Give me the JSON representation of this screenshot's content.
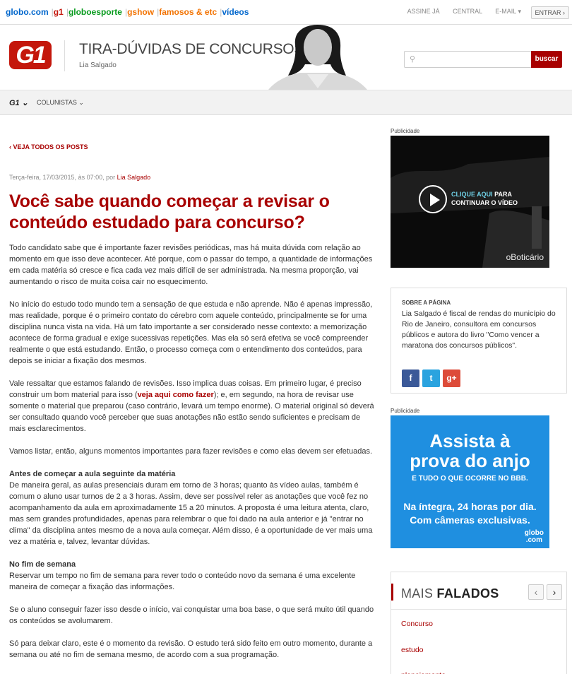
{
  "topbar": {
    "sites": [
      {
        "label": "globo.com",
        "color": "#0066cc"
      },
      {
        "label": "g1",
        "color": "#c4170c"
      },
      {
        "label": "globoesporte",
        "color": "#069a1c"
      },
      {
        "label": "gshow",
        "color": "#f27200"
      },
      {
        "label": "famosos & etc",
        "color": "#f27200"
      },
      {
        "label": "vídeos",
        "color": "#0066cc"
      }
    ],
    "links": [
      "ASSINE JÁ",
      "CENTRAL",
      "E-MAIL ▾"
    ],
    "entrar": "ENTRAR ›"
  },
  "header": {
    "logo": "G1",
    "blog_title": "TIRA-DÚVIDAS DE CONCURSOS",
    "blog_author": "Lia Salgado",
    "search_button": "buscar",
    "search_placeholder": ""
  },
  "nav": {
    "g1": "G1 ⌄",
    "colunistas": "COLUNISTAS ⌄"
  },
  "article": {
    "back_link": "‹ VEJA TODOS OS POSTS",
    "meta_date": "Terça-feira, 17/03/2015, às 07:00, por ",
    "meta_author": "Lia Salgado",
    "headline": "Você sabe quando começar a revisar o conteúdo estudado para concurso?",
    "p1": "Todo candidato sabe que é importante fazer revisões periódicas, mas há muita dúvida com relação ao momento em que isso deve acontecer. Até porque, com o passar do tempo, a quantidade de informações em cada matéria só cresce e fica cada vez mais difícil de ser administrada. Na mesma proporção, vai aumentando o risco de muita coisa cair no esquecimento.",
    "p2": "No início do estudo todo mundo tem a sensação de que estuda e não aprende. Não é apenas impressão, mas realidade, porque é o primeiro contato do cérebro com aquele conteúdo, principalmente se for uma disciplina nunca vista na vida. Há um fato importante a ser considerado nesse contexto: a memorização acontece de forma gradual e exige sucessivas repetições. Mas ela só será efetiva se você compreender realmente o que está estudando. Então, o processo começa com o entendimento dos conteúdos, para depois se iniciar a fixação dos mesmos.",
    "p3a": "Vale ressaltar que estamos falando de revisões. Isso  implica duas coisas. Em primeiro lugar, é preciso construir um bom material para isso (",
    "p3link": "veja aqui como fazer",
    "p3b": "); e, em segundo, na hora de revisar use somente o material que preparou (caso contrário, levará um tempo enorme). O material original só deverá ser consultado quando você perceber que suas anotações não estão sendo suficientes e precisam de mais esclarecimentos.",
    "p4": "Vamos listar, então, alguns momentos importantes para fazer revisões e como elas devem ser efetuadas.",
    "sub1": "Antes de começar a aula seguinte da matéria",
    "p5": "De maneira geral, as aulas presenciais duram em torno de 3 horas; quanto às vídeo aulas, também é comum o aluno usar turnos de 2 a 3 horas. Assim, deve ser possível reler as anotações que você fez no acompanhamento da aula em aproximadamente 15 a 20 minutos. A proposta é uma leitura atenta, claro, mas sem grandes profundidades, apenas para relembrar o que foi dado na aula anterior e já \"entrar no clima\" da disciplina antes mesmo de a nova aula começar. Além disso, é a oportunidade de ver mais uma vez a matéria e, talvez, levantar dúvidas.",
    "sub2": "No fim de semana",
    "p6": "Reservar um tempo no fim de semana para rever todo o conteúdo novo da semana é uma excelente maneira de começar a fixação das informações.",
    "p7": "Se o aluno conseguir fazer isso desde o início, vai conquistar uma boa base, o que será muito útil quando os conteúdos se avolumarem.",
    "p8": "Só para deixar claro, este é o momento da revisão. O estudo terá sido feito em outro momento, durante a semana ou até no fim de semana mesmo, de acordo com a sua programação."
  },
  "sidebar": {
    "pub_label": "Publicidade",
    "ad1": {
      "cta_highlight": "CLIQUE AQUI",
      "cta_rest1": " PARA",
      "cta_line2": "CONTINUAR O VÍDEO",
      "brand": "oBoticário"
    },
    "about": {
      "title": "SOBRE A PÁGINA",
      "text": "Lia Salgado é fiscal de rendas do município do Rio de Janeiro, consultora em concursos públicos e autora do livro \"Como vencer a maratona dos concursos públicos\".",
      "social": {
        "facebook": "f",
        "twitter": "t",
        "gplus": "g+"
      }
    },
    "ad2": {
      "line1": "Assista à",
      "line2": "prova do anjo",
      "line3": "E TUDO O QUE OCORRE NO BBB.",
      "line4a": "Na íntegra, 24 horas por dia.",
      "line4b": "Com câmeras exclusivas.",
      "logo1": "globo",
      "logo2": ".com"
    },
    "mais_falados": {
      "title_light": "MAIS ",
      "title_bold": "FALADOS",
      "items": [
        "Concurso",
        "estudo",
        "planejamento"
      ]
    }
  }
}
